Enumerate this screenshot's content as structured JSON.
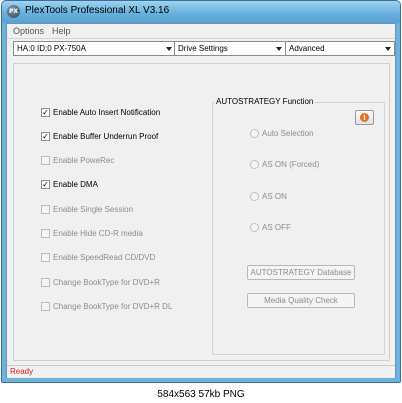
{
  "window": {
    "title": "PlexTools Professional XL V3.16",
    "icon": "plextools-app-icon",
    "icon_text": "PX"
  },
  "menu": [
    "Options",
    "Help"
  ],
  "toolbar": {
    "drive_select": "HA:0 ID:0  PX-750A",
    "settings_select": "Drive Settings",
    "mode_select": "Advanced"
  },
  "options": [
    {
      "label": "Enable Auto Insert Notification",
      "checked": true,
      "enabled": true
    },
    {
      "label": "Enable Buffer Underrun Proof",
      "checked": true,
      "enabled": true
    },
    {
      "label": "Enable PoweRec",
      "checked": false,
      "enabled": false
    },
    {
      "label": "Enable DMA",
      "checked": true,
      "enabled": true
    },
    {
      "label": "Enable Single Session",
      "checked": false,
      "enabled": false
    },
    {
      "label": "Enable Hide CD-R media",
      "checked": false,
      "enabled": false
    },
    {
      "label": "Enable SpeedRead CD/DVD",
      "checked": false,
      "enabled": false
    },
    {
      "label": "Change BookType for DVD+R",
      "checked": false,
      "enabled": false
    },
    {
      "label": "Change BookType for DVD+R DL",
      "checked": false,
      "enabled": false
    }
  ],
  "autostrategy": {
    "title": "AUTOSTRATEGY Function",
    "info_icon": "info-icon",
    "info_glyph": "i",
    "radios": [
      "Auto Selection",
      "AS ON (Forced)",
      "AS ON",
      "AS OFF"
    ],
    "database_button": "AUTOSTRATEGY Database",
    "quality_button": "Media Quality Check"
  },
  "status": {
    "text": "Ready",
    "color": "#e31b1b"
  },
  "caption": "584x563 57kb PNG",
  "colors": {
    "title_bar": "#6cb2dd",
    "status_text": "#e31b1b",
    "info_icon": "#e2711d"
  }
}
